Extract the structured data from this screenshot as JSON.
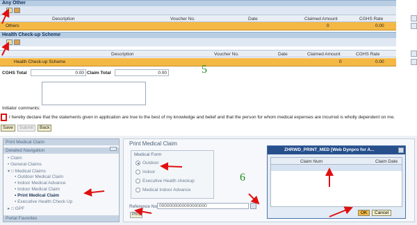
{
  "any_other": {
    "section_title": "Any Other",
    "columns": [
      "Description",
      "Voucher No.",
      "Date",
      "Claimed Amount",
      "CGHS Rate"
    ],
    "row": {
      "label": "Others",
      "claimed_amount": "0",
      "cghs_rate": "0.00"
    }
  },
  "health_checkup": {
    "section_title": "Health Check-up Scheme",
    "columns": [
      "Description",
      "Voucher No.",
      "Date",
      "Claimed Amount",
      "CGHS Rate"
    ],
    "row": {
      "label": "Health Check-up Scheme",
      "claimed_amount": "0",
      "cghs_rate": "0.00"
    }
  },
  "totals": {
    "cghs_total_label": "CGHS Total",
    "cghs_total_value": "0.00",
    "claim_total_label": "Claim Total",
    "claim_total_value": "0.00"
  },
  "step_labels": {
    "step5": "5",
    "step6": "6"
  },
  "comments": {
    "label": "Initiator comments:"
  },
  "declaration": {
    "text": "I hereby declare that the statements given in application are true to the best of my knowledge and belief and that the person for whom medical expenses are incurred is wholly dependent on me."
  },
  "actions": {
    "save": "Save",
    "submit": "Submit",
    "back": "Back"
  },
  "navigation": {
    "top_title": "Print Medical Claim",
    "detailed_title": "Detailed Navigation",
    "items": [
      "• Claim",
      "• General Claims",
      "▾ □ Medical Claims",
      "• Outdoor Medical Claim",
      "• Indoor Medical Advance",
      "• Indoor Medical Claim",
      "• Print Medical Claim",
      "• Executive Health Check Up",
      "▸ □ GPF"
    ],
    "portal_title": "Portal Favorites"
  },
  "print_claim": {
    "title": "Print Medical Claim",
    "form_title": "Medical Form",
    "options": [
      "Outdoor",
      "Indoor",
      "Executive Health checkup",
      "Medical Indoor Advance"
    ],
    "ref_label": "Reference No.:",
    "ref_value": "0000000000000000000",
    "print_button": "Print"
  },
  "popup": {
    "title": "ZHRWD_PRINT_MED [Web Dynpro for A...",
    "col_claim_num": "Claim Num",
    "col_claim_date": "Claim Date",
    "ok": "OK",
    "cancel": "Cancel"
  },
  "colors": {
    "accent_orange": "#f4b845",
    "sap_blue": "#264f8c",
    "annotation_red": "#e01010",
    "step_green": "#1e8a1e"
  }
}
